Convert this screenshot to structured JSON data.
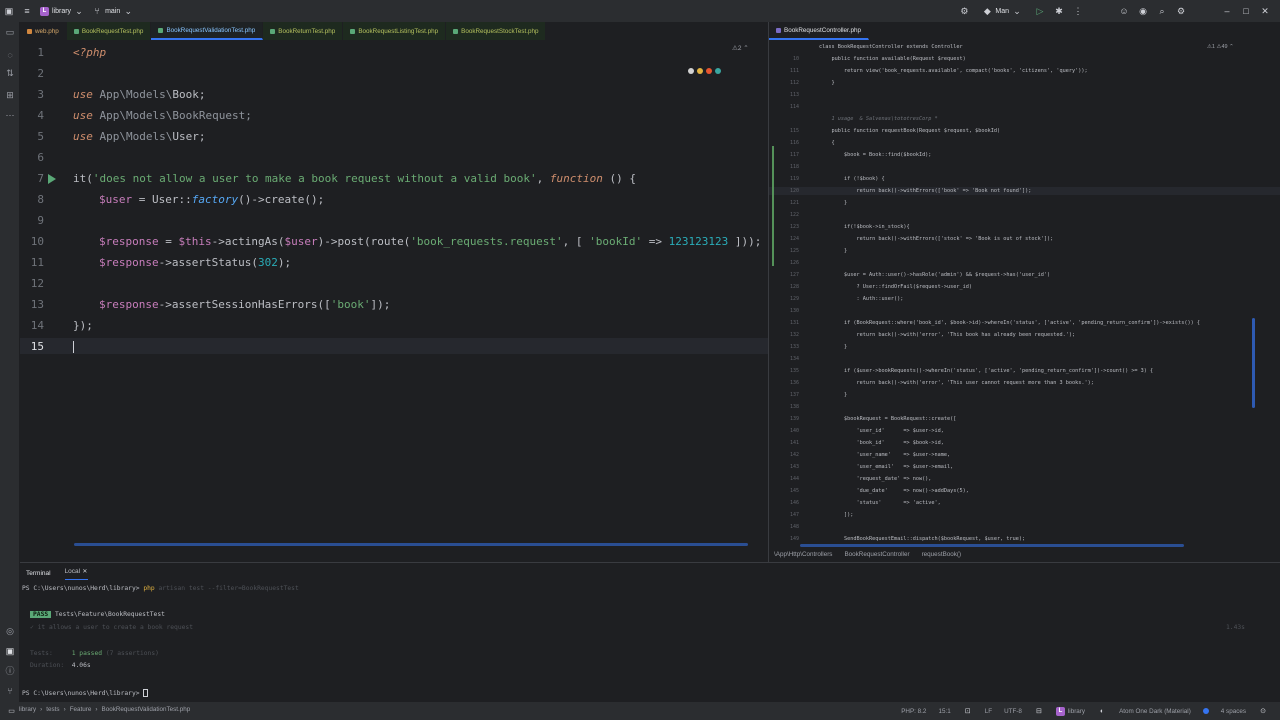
{
  "titlebar": {
    "project_badge": "L",
    "project": "library",
    "branch": "main",
    "run_config": "Man"
  },
  "tabs_left": [
    {
      "label": "web.php",
      "kind": "plain"
    },
    {
      "label": "BookRequestTest.php",
      "kind": "test"
    },
    {
      "label": "BookRequestValidationTest.php",
      "kind": "active"
    },
    {
      "label": "BookReturnTest.php",
      "kind": "test"
    },
    {
      "label": "BookRequestListingTest.php",
      "kind": "test"
    },
    {
      "label": "BookRequestStockTest.php",
      "kind": "test"
    }
  ],
  "inspection_left": "⚠2 ⌃",
  "editor_left": {
    "line_numbers": [
      "1",
      "2",
      "3",
      "4",
      "5",
      "6",
      "7",
      "8",
      "9",
      "10",
      "11",
      "12",
      "13",
      "14",
      "15"
    ],
    "lines": {
      "l1": "<?php",
      "l3_kw": "use",
      "l3_ns": "App\\Models\\",
      "l3_cls": "Book;",
      "l4_kw": "use",
      "l4_ns": "App\\Models\\",
      "l4_cls": "BookRequest;",
      "l5_kw": "use",
      "l5_ns": "App\\Models\\",
      "l5_cls": "User;",
      "l7_a": "it(",
      "l7_str": "'does not allow a user to make a book request without a valid book'",
      "l7_b": ", ",
      "l7_kw": "function",
      "l7_c": " () {",
      "l8_var": "$user",
      "l8_a": " = User::",
      "l8_fn": "factory",
      "l8_b": "()->create();",
      "l10_var": "$response",
      "l10_a": " = ",
      "l10_this": "$this",
      "l10_b": "->actingAs(",
      "l10_var2": "$user",
      "l10_c": ")->post(route(",
      "l10_str": "'book_requests.request'",
      "l10_d": ", [ ",
      "l10_str2": "'bookId'",
      "l10_e": " => ",
      "l10_num": "123123123",
      "l10_f": " ]));",
      "l11_var": "$response",
      "l11_a": "->assertStatus(",
      "l11_num": "302",
      "l11_b": ");",
      "l13_var": "$response",
      "l13_a": "->assertSessionHasErrors([",
      "l13_str": "'book'",
      "l13_b": "]);",
      "l14": "});"
    }
  },
  "tab_right": {
    "label": "BookRequestController.php"
  },
  "inspection_right": "⚠1 ⚠49 ⌃",
  "editor_right": {
    "rows": [
      {
        "ln": "",
        "text": "class BookRequestController extends Controller"
      },
      {
        "ln": "10",
        "text": "    public function available(Request $request)"
      },
      {
        "ln": "111",
        "text": "        return view('book_requests.available', compact('books', 'citizens', 'query'));"
      },
      {
        "ln": "112",
        "text": "    }"
      },
      {
        "ln": "113",
        "text": ""
      },
      {
        "ln": "114",
        "text": ""
      },
      {
        "ln": "",
        "text": "    1 usage  & Salvenas\\tototresCorp *",
        "hint": true
      },
      {
        "ln": "115",
        "text": "    public function requestBook(Request $request, $bookId)"
      },
      {
        "ln": "116",
        "text": "    {"
      },
      {
        "ln": "117",
        "text": "        $book = Book::find($bookId);"
      },
      {
        "ln": "118",
        "text": ""
      },
      {
        "ln": "119",
        "text": "        if (!$book) {"
      },
      {
        "ln": "120",
        "text": "            return back()->withErrors(['book' => 'Book not found']);"
      },
      {
        "ln": "121",
        "text": "        }"
      },
      {
        "ln": "122",
        "text": ""
      },
      {
        "ln": "123",
        "text": "        if(!$book->in_stock){"
      },
      {
        "ln": "124",
        "text": "            return back()->withErrors(['stock' => 'Book is out of stock']);"
      },
      {
        "ln": "125",
        "text": "        }"
      },
      {
        "ln": "126",
        "text": ""
      },
      {
        "ln": "127",
        "text": "        $user = Auth::user()->hasRole('admin') && $request->has('user_id')"
      },
      {
        "ln": "128",
        "text": "            ? User::findOrFail($request->user_id)"
      },
      {
        "ln": "129",
        "text": "            : Auth::user();"
      },
      {
        "ln": "130",
        "text": ""
      },
      {
        "ln": "131",
        "text": "        if (BookRequest::where('book_id', $book->id)->whereIn('status', ['active', 'pending_return_confirm'])->exists()) {"
      },
      {
        "ln": "132",
        "text": "            return back()->with('error', 'This book has already been requested.');"
      },
      {
        "ln": "133",
        "text": "        }"
      },
      {
        "ln": "134",
        "text": ""
      },
      {
        "ln": "135",
        "text": "        if ($user->bookRequests()->whereIn('status', ['active', 'pending_return_confirm'])->count() >= 3) {"
      },
      {
        "ln": "136",
        "text": "            return back()->with('error', 'This user cannot request more than 3 books.');"
      },
      {
        "ln": "137",
        "text": "        }"
      },
      {
        "ln": "138",
        "text": ""
      },
      {
        "ln": "139",
        "text": "        $bookRequest = BookRequest::create(["
      },
      {
        "ln": "140",
        "text": "            'user_id'      => $user->id,"
      },
      {
        "ln": "141",
        "text": "            'book_id'      => $book->id,"
      },
      {
        "ln": "142",
        "text": "            'user_name'    => $user->name,"
      },
      {
        "ln": "143",
        "text": "            'user_email'   => $user->email,"
      },
      {
        "ln": "144",
        "text": "            'request_date' => now(),"
      },
      {
        "ln": "145",
        "text": "            'due_date'     => now()->addDays(5),"
      },
      {
        "ln": "146",
        "text": "            'status'       => 'active',"
      },
      {
        "ln": "147",
        "text": "        ]);"
      },
      {
        "ln": "148",
        "text": ""
      },
      {
        "ln": "149",
        "text": "        SendBookRequestEmail::dispatch($bookRequest, $user, true);"
      }
    ]
  },
  "breadcrumb_right": [
    "\\App\\Http\\Controllers",
    "BookRequestController",
    "requestBook()"
  ],
  "terminal": {
    "tab_title": "Terminal",
    "tab_local": "Local",
    "cmd_prompt": "PS C:\\Users\\nunos\\Herd\\library>",
    "cmd": "php",
    "cmd_args": "artisan test --filter=BookRequestTest",
    "pass": "PASS",
    "pass_target": "Tests\\Feature\\BookRequestTest",
    "case": "✓ it allows a user to create a book request",
    "case_time": "1.43s",
    "tests_label": "Tests:",
    "tests_passed": "1 passed",
    "tests_assert": "(7 assertions)",
    "duration_label": "Duration:",
    "duration": "4.06s",
    "prompt2": "PS C:\\Users\\nunos\\Herd\\library>"
  },
  "statusbar": {
    "path": [
      "library",
      "tests",
      "Feature",
      "BookRequestValidationTest.php"
    ],
    "php": "PHP: 8.2",
    "pos": "15:1",
    "eol": "LF",
    "enc": "UTF-8",
    "project": "library",
    "theme": "Atom One Dark (Material)",
    "indent": "4 spaces"
  }
}
